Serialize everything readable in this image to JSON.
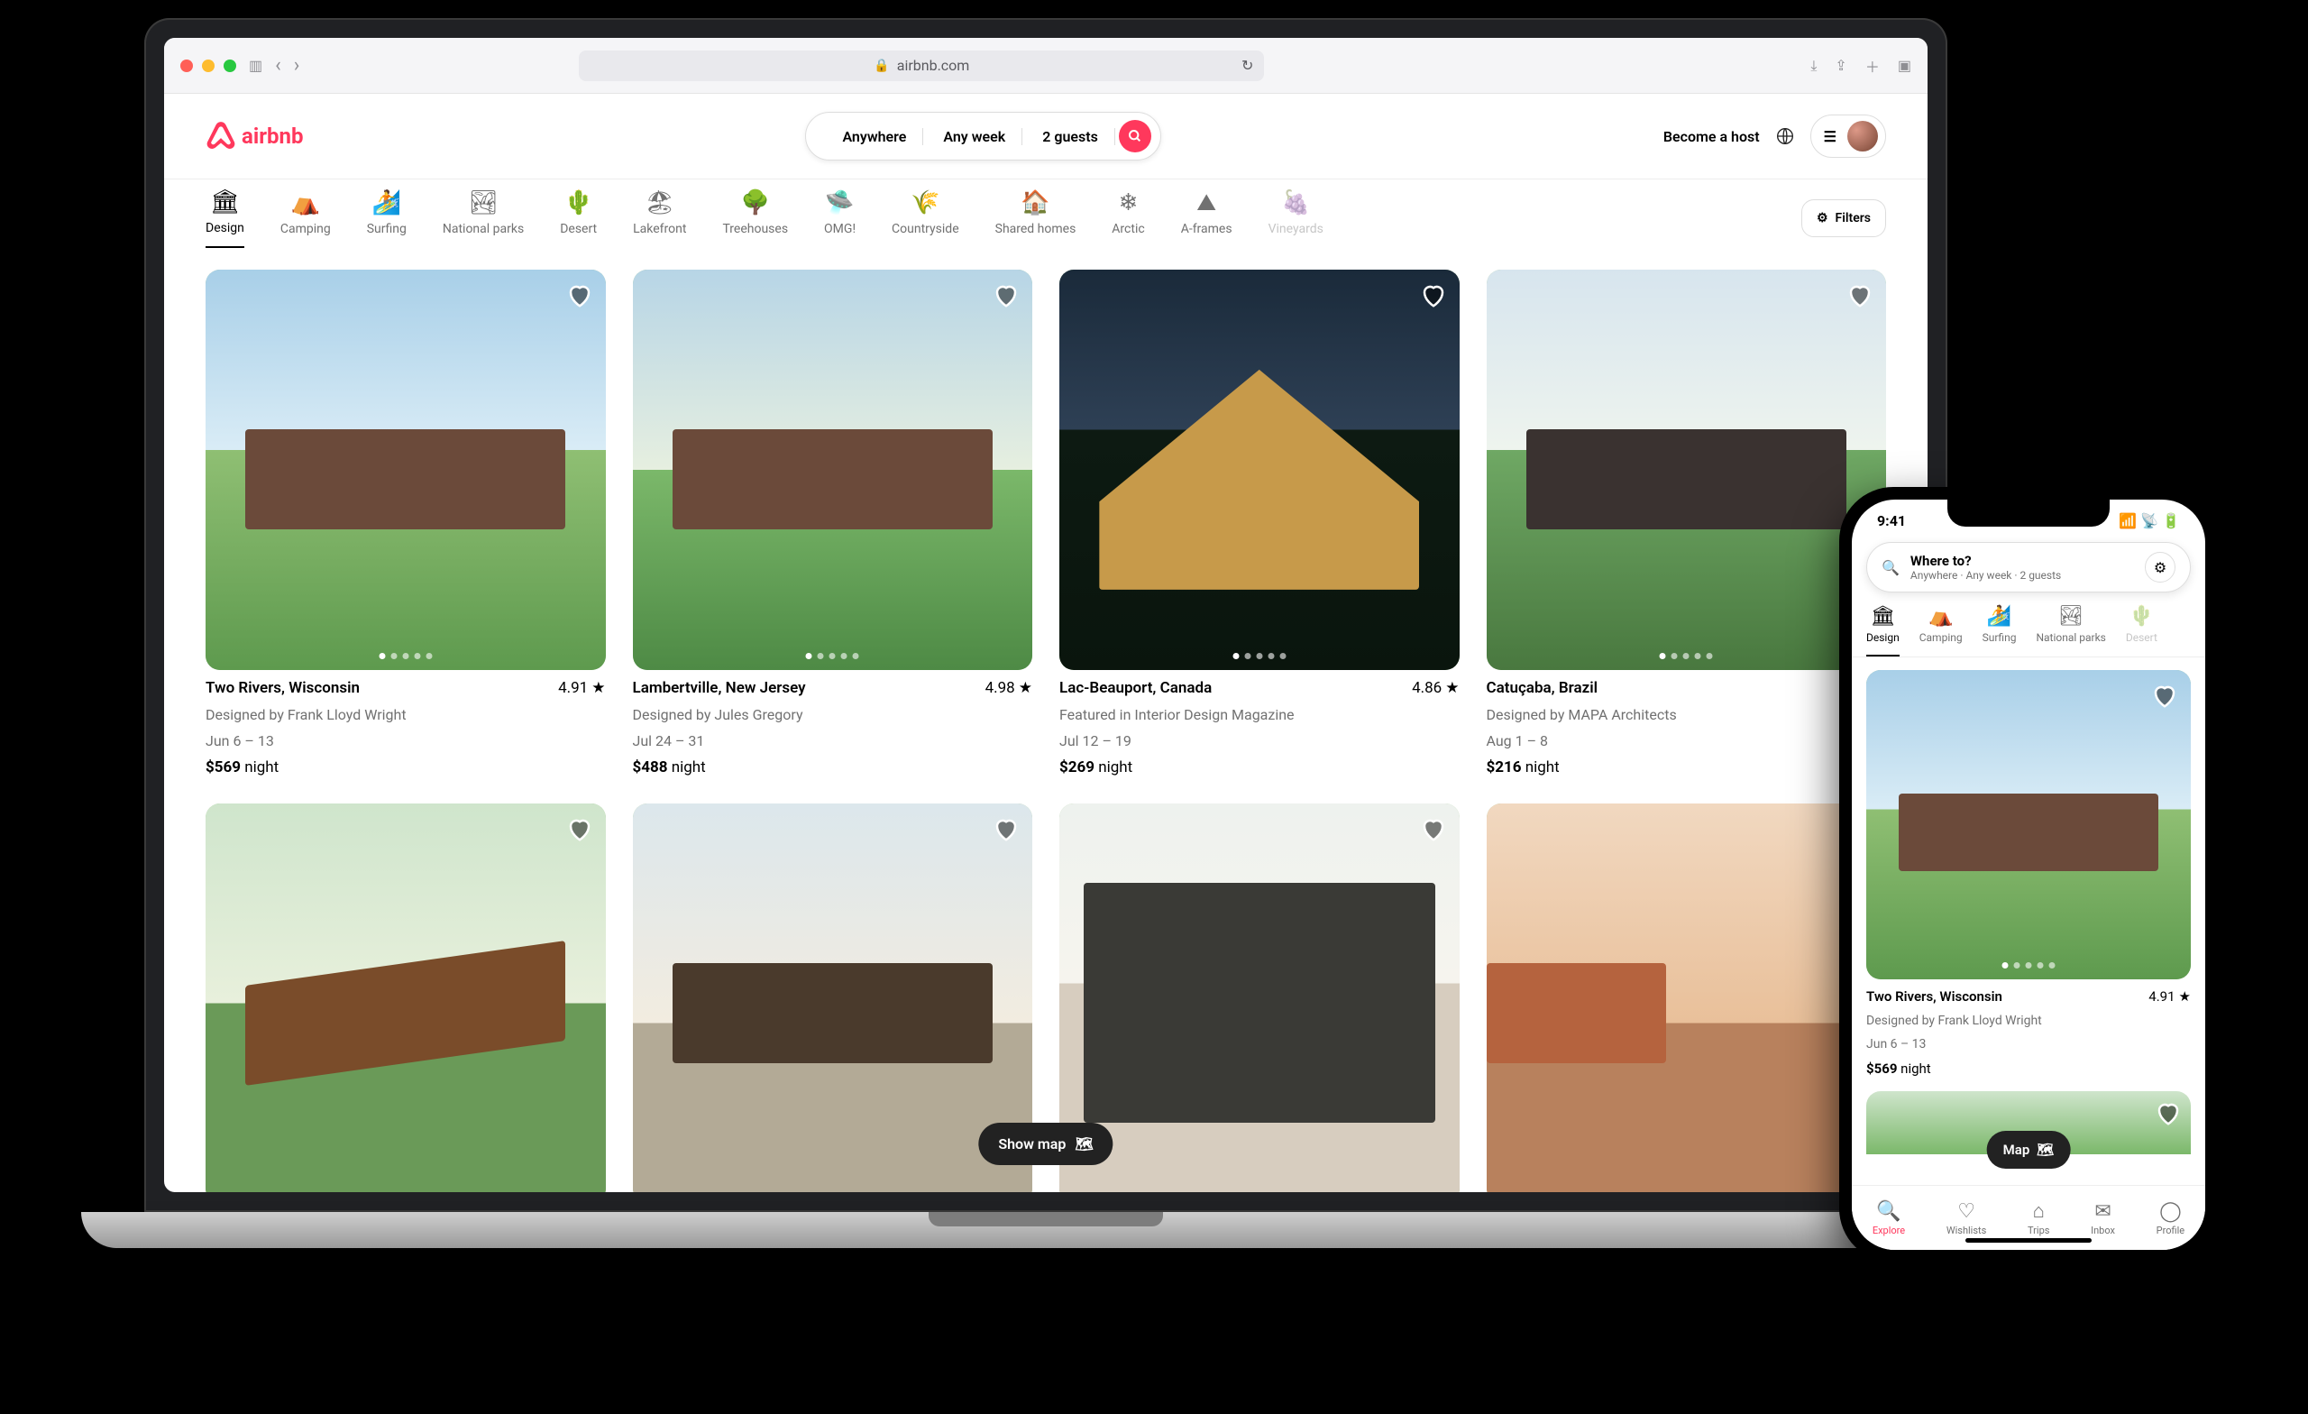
{
  "browser": {
    "url": "airbnb.com"
  },
  "header": {
    "brand": "airbnb",
    "search": {
      "where": "Anywhere",
      "when": "Any week",
      "who": "2 guests"
    },
    "host_cta": "Become a host"
  },
  "categories": [
    {
      "label": "Design",
      "icon": "🏛"
    },
    {
      "label": "Camping",
      "icon": "⛺"
    },
    {
      "label": "Surfing",
      "icon": "🏄"
    },
    {
      "label": "National parks",
      "icon": "🏞"
    },
    {
      "label": "Desert",
      "icon": "🌵"
    },
    {
      "label": "Lakefront",
      "icon": "🏖"
    },
    {
      "label": "Treehouses",
      "icon": "🌳"
    },
    {
      "label": "OMG!",
      "icon": "🛸"
    },
    {
      "label": "Countryside",
      "icon": "🌾"
    },
    {
      "label": "Shared homes",
      "icon": "🏠"
    },
    {
      "label": "Arctic",
      "icon": "❄"
    },
    {
      "label": "A-frames",
      "icon": "⛰"
    },
    {
      "label": "Vineyards",
      "icon": "🍇"
    }
  ],
  "filters_label": "Filters",
  "listings": [
    {
      "title": "Two Rivers, Wisconsin",
      "rating": "4.91",
      "sub": "Designed by Frank Lloyd Wright",
      "dates": "Jun 6 – 13",
      "price": "$569",
      "unit": "night"
    },
    {
      "title": "Lambertville, New Jersey",
      "rating": "4.98",
      "sub": "Designed by Jules Gregory",
      "dates": "Jul 24 – 31",
      "price": "$488",
      "unit": "night"
    },
    {
      "title": "Lac-Beauport, Canada",
      "rating": "4.86",
      "sub": "Featured in Interior Design Magazine",
      "dates": "Jul 12 – 19",
      "price": "$269",
      "unit": "night"
    },
    {
      "title": "Catuçaba, Brazil",
      "rating": "",
      "sub": "Designed by MAPA Architects",
      "dates": "Aug 1 – 8",
      "price": "$216",
      "unit": "night"
    }
  ],
  "showmap_label": "Show map",
  "phone": {
    "status_time": "9:41",
    "search_title": "Where to?",
    "search_sub": "Anywhere · Any week · 2 guests",
    "map_label": "Map",
    "tabs": [
      {
        "label": "Explore",
        "icon": "🔍"
      },
      {
        "label": "Wishlists",
        "icon": "♡"
      },
      {
        "label": "Trips",
        "icon": "⌂"
      },
      {
        "label": "Inbox",
        "icon": "✉"
      },
      {
        "label": "Profile",
        "icon": "◯"
      }
    ],
    "listing": {
      "title": "Two Rivers, Wisconsin",
      "rating": "4.91",
      "sub": "Designed by Frank Lloyd Wright",
      "dates": "Jun 6 – 13",
      "price": "$569",
      "unit": "night"
    }
  }
}
